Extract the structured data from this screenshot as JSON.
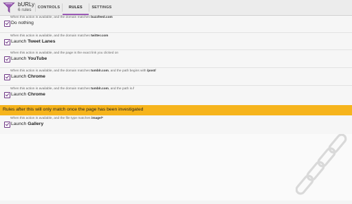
{
  "app": {
    "title": "bURLy",
    "subtitle": "6 rules",
    "icon": "funnel-icon",
    "accent": "#9b59b6"
  },
  "tabs": [
    {
      "label": "CONTROLS",
      "active": false
    },
    {
      "label": "RULES",
      "active": true
    },
    {
      "label": "SETTINGS",
      "active": false
    }
  ],
  "rules_before": [
    {
      "desc_prefix": "When this action is available, and the domain matches ",
      "desc_bold": "buzzfeed.com",
      "desc_suffix": "",
      "checked": true,
      "action_prefix": "Do nothing",
      "action_bold": ""
    },
    {
      "desc_prefix": "When this action is available, and the domain matches ",
      "desc_bold": "twitter.com",
      "desc_suffix": "",
      "checked": true,
      "action_prefix": "Launch ",
      "action_bold": "Tweet Lanes"
    },
    {
      "desc_prefix": "When this action is available, and the page is the exact link you clicked on",
      "desc_bold": "",
      "desc_suffix": "",
      "checked": true,
      "action_prefix": "Launch ",
      "action_bold": "YouTube"
    },
    {
      "desc_prefix": "When this action is available, and the domain matches ",
      "desc_bold": "tumblr.com",
      "desc_suffix": ", and the path begins with ",
      "desc_bold2": "/post/",
      "checked": true,
      "action_prefix": "Launch ",
      "action_bold": "Chrome"
    },
    {
      "desc_prefix": "When this action is available, and the domain matches ",
      "desc_bold": "tumblr.com",
      "desc_suffix": ", and the path is ",
      "desc_bold2": "/",
      "checked": true,
      "action_prefix": "Launch ",
      "action_bold": "Chrome"
    }
  ],
  "banner": "Rules after this will only match once the page has been investigated",
  "rules_after": [
    {
      "desc_prefix": "When this action is available, and the file type matches ",
      "desc_bold": "image/*",
      "checked": true,
      "action_prefix": "Launch ",
      "action_bold": "Gallery"
    }
  ],
  "watermark": "chain-link-icon"
}
